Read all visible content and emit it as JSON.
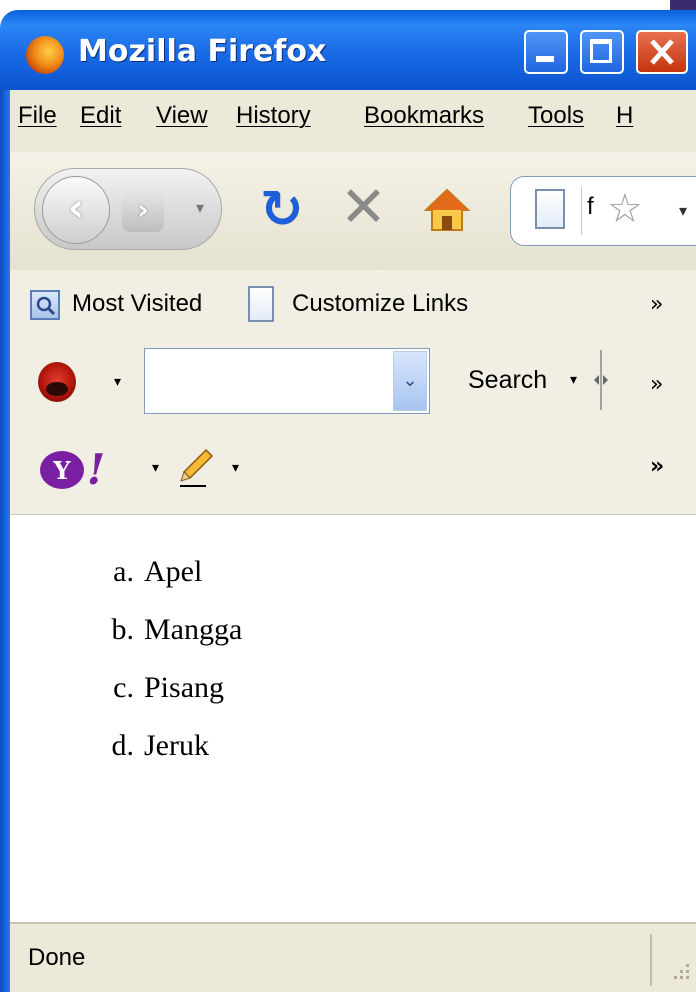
{
  "window": {
    "title": "Mozilla Firefox"
  },
  "menu": {
    "items": [
      "File",
      "Edit",
      "View",
      "History",
      "Bookmarks",
      "Tools",
      "H"
    ]
  },
  "nav": {
    "url_text": "f"
  },
  "bookmarks": {
    "items": [
      "Most Visited",
      "Customize Links"
    ],
    "overflow": "»"
  },
  "search_toolbar": {
    "input_value": "",
    "search_label": "Search",
    "overflow": "»"
  },
  "yahoo_toolbar": {
    "overflow": "»"
  },
  "content": {
    "list": [
      {
        "marker": "a.",
        "text": "Apel"
      },
      {
        "marker": "b.",
        "text": "Mangga"
      },
      {
        "marker": "c.",
        "text": "Pisang"
      },
      {
        "marker": "d.",
        "text": "Jeruk"
      }
    ]
  },
  "status": {
    "text": "Done"
  },
  "colors": {
    "titlebar": "#0a5fdc",
    "close_button": "#c5340e",
    "chrome": "#ece9d8"
  }
}
